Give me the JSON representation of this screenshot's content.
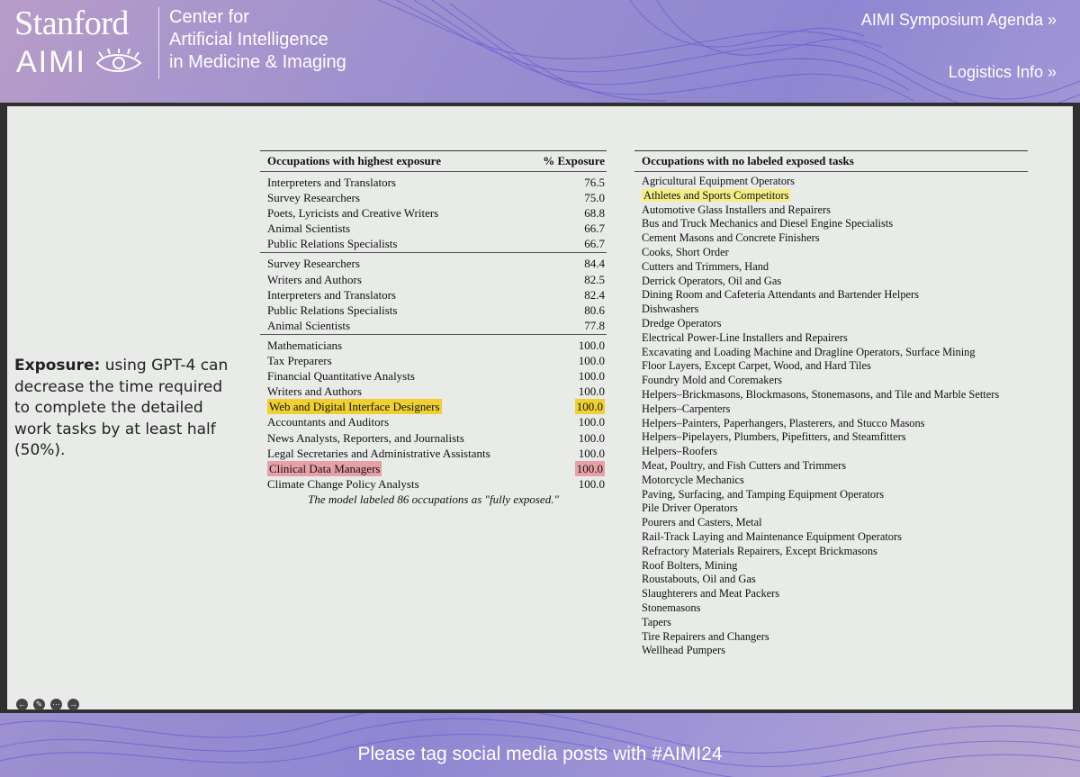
{
  "header": {
    "logo_stanford": "Stanford",
    "logo_aimi": "AIMI",
    "center_name": [
      "Center for",
      "Artificial Intelligence",
      "in Medicine & Imaging"
    ],
    "links": [
      "AIMI Symposium Agenda »",
      "Logistics Info »"
    ]
  },
  "slide": {
    "note_term": "Exposure:",
    "note_text": " using GPT-4 can decrease the time required to complete the detailed work tasks by at least half (50%).",
    "left_table": {
      "headers": [
        "Occupations with highest exposure",
        "% Exposure"
      ],
      "groups": [
        [
          {
            "name": "Interpreters and Translators",
            "value": "76.5"
          },
          {
            "name": "Survey Researchers",
            "value": "75.0"
          },
          {
            "name": "Poets, Lyricists and Creative Writers",
            "value": "68.8"
          },
          {
            "name": "Animal Scientists",
            "value": "66.7"
          },
          {
            "name": "Public Relations Specialists",
            "value": "66.7"
          }
        ],
        [
          {
            "name": "Survey Researchers",
            "value": "84.4"
          },
          {
            "name": "Writers and Authors",
            "value": "82.5"
          },
          {
            "name": "Interpreters and Translators",
            "value": "82.4"
          },
          {
            "name": "Public Relations Specialists",
            "value": "80.6"
          },
          {
            "name": "Animal Scientists",
            "value": "77.8"
          }
        ],
        [
          {
            "name": "Mathematicians",
            "value": "100.0"
          },
          {
            "name": "Tax Preparers",
            "value": "100.0"
          },
          {
            "name": "Financial Quantitative Analysts",
            "value": "100.0"
          },
          {
            "name": "Writers and Authors",
            "value": "100.0"
          },
          {
            "name": "Web and Digital Interface Designers",
            "value": "100.0",
            "highlight": "yellow"
          },
          {
            "name": "Accountants and Auditors",
            "value": "100.0"
          },
          {
            "name": "News Analysts, Reporters, and Journalists",
            "value": "100.0"
          },
          {
            "name": "Legal Secretaries and Administrative Assistants",
            "value": "100.0"
          },
          {
            "name": "Clinical Data Managers",
            "value": "100.0",
            "highlight": "red"
          },
          {
            "name": "Climate Change Policy Analysts",
            "value": "100.0"
          }
        ]
      ],
      "caption": "The model labeled 86 occupations as \"fully exposed.\""
    },
    "right_table": {
      "header": "Occupations with no labeled exposed tasks",
      "highlight_index": 1,
      "rows": [
        "Agricultural Equipment Operators",
        "Athletes and Sports Competitors",
        "Automotive Glass Installers and Repairers",
        "Bus and Truck Mechanics and Diesel Engine Specialists",
        "Cement Masons and Concrete Finishers",
        "Cooks, Short Order",
        "Cutters and Trimmers, Hand",
        "Derrick Operators, Oil and Gas",
        "Dining Room and Cafeteria Attendants and Bartender Helpers",
        "Dishwashers",
        "Dredge Operators",
        "Electrical Power-Line Installers and Repairers",
        "Excavating and Loading Machine and Dragline Operators, Surface Mining",
        "Floor Layers, Except Carpet, Wood, and Hard Tiles",
        "Foundry Mold and Coremakers",
        "Helpers–Brickmasons, Blockmasons, Stonemasons, and Tile and Marble Setters",
        "Helpers–Carpenters",
        "Helpers–Painters, Paperhangers, Plasterers, and Stucco Masons",
        "Helpers–Pipelayers, Plumbers, Pipefitters, and Steamfitters",
        "Helpers–Roofers",
        "Meat, Poultry, and Fish Cutters and Trimmers",
        "Motorcycle Mechanics",
        "Paving, Surfacing, and Tamping Equipment Operators",
        "Pile Driver Operators",
        "Pourers and Casters, Metal",
        "Rail-Track Laying and Maintenance Equipment Operators",
        "Refractory Materials Repairers, Except Brickmasons",
        "Roof Bolters, Mining",
        "Roustabouts, Oil and Gas",
        "Slaughterers and Meat Packers",
        "Stonemasons",
        "Tapers",
        "Tire Repairers and Changers",
        "Wellhead Pumpers"
      ]
    },
    "controls": [
      "back-icon",
      "pen-icon",
      "more-icon",
      "forward-icon"
    ]
  },
  "footer": {
    "text": "Please tag social media posts with #AIMI24"
  },
  "colors": {
    "highlight_yellow": "#f0d030",
    "highlight_red": "#e8a0a8",
    "highlight_lightyellow": "#f5ee86"
  }
}
